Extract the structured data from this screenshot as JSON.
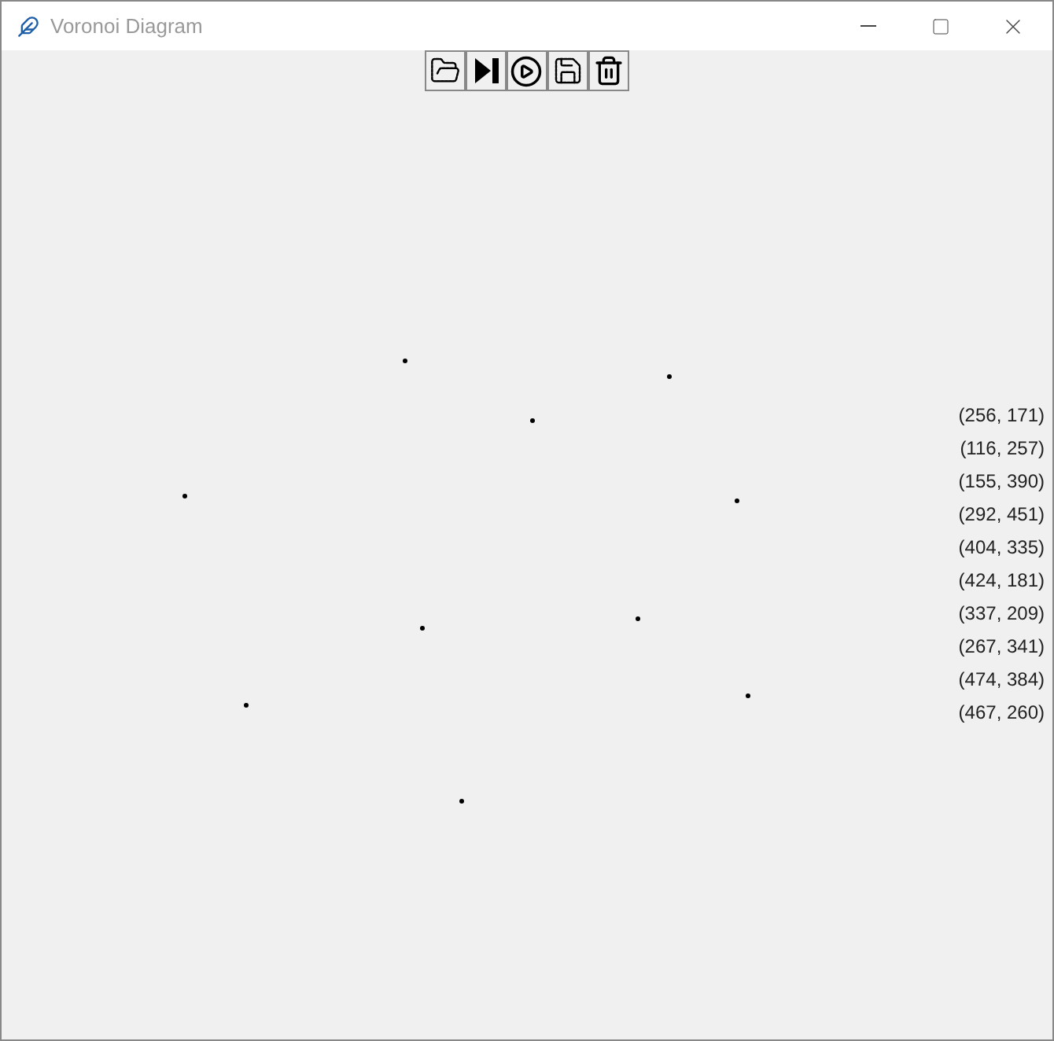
{
  "window": {
    "title": "Voronoi Diagram"
  },
  "points": [
    {
      "label": "(256, 171)"
    },
    {
      "label": "(116, 257)"
    },
    {
      "label": "(155, 390)"
    },
    {
      "label": "(292, 451)"
    },
    {
      "label": "(404, 335)"
    },
    {
      "label": "(424, 181)"
    },
    {
      "label": "(337, 209)"
    },
    {
      "label": "(267, 341)"
    },
    {
      "label": "(474, 384)"
    },
    {
      "label": "(467, 260)"
    }
  ]
}
